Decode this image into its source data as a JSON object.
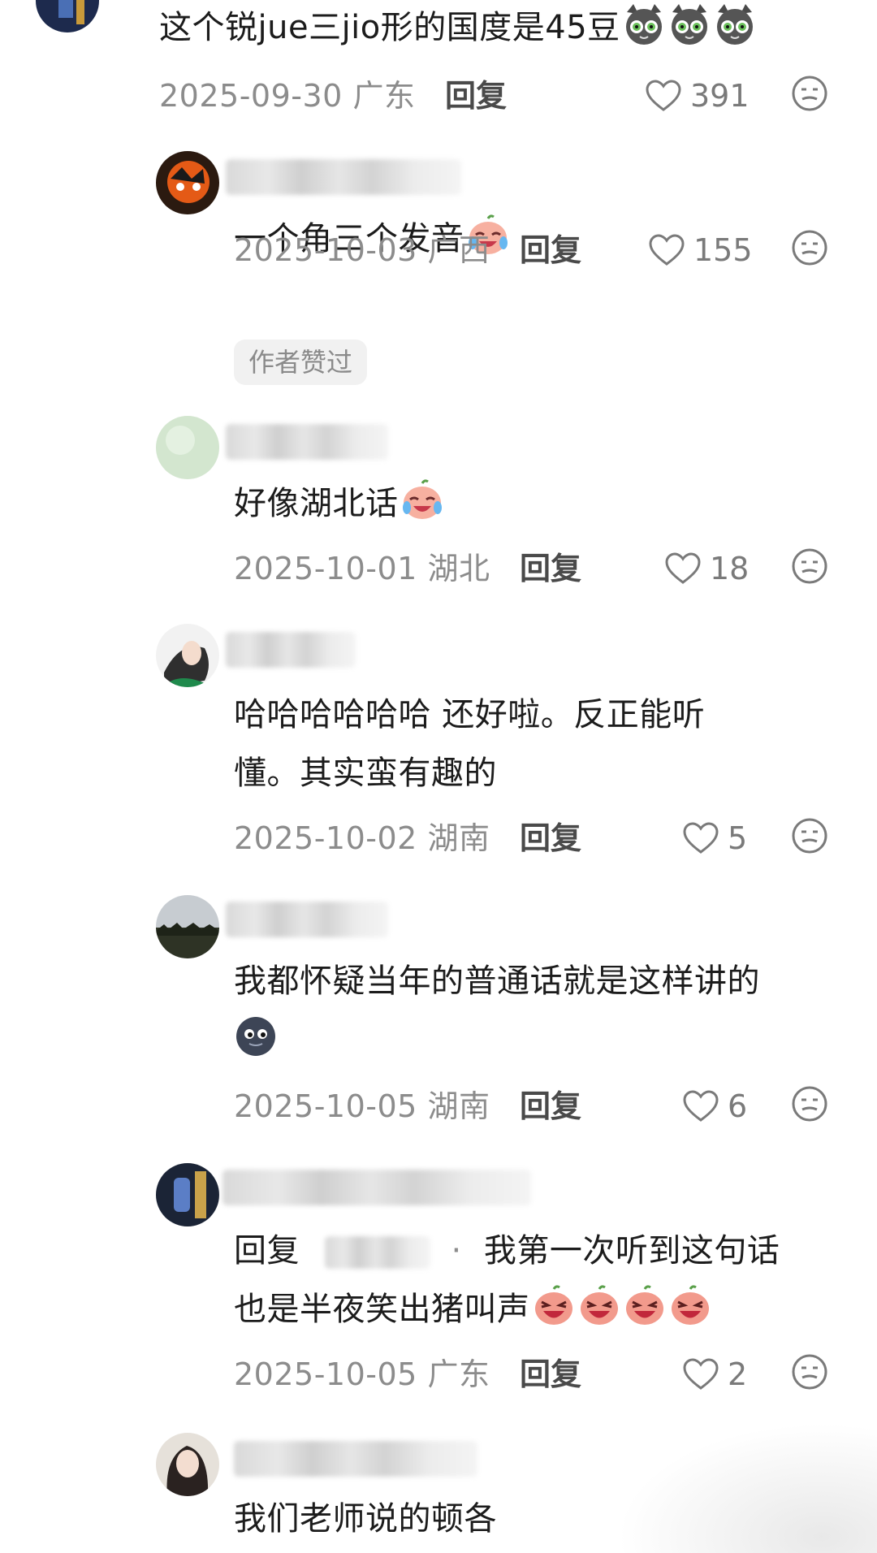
{
  "comments": [
    {
      "text": "这个锐jue三jio形的国度是45豆",
      "emojis": [
        "cat-emoji",
        "cat-emoji",
        "cat-emoji"
      ],
      "date": "2025-09-30",
      "location": "广东",
      "reply": "回复",
      "likes": "391"
    },
    {
      "username": "",
      "text": "一个角三个发音",
      "emojis": [
        "crying-laugh-emoji"
      ],
      "date": "2025-10-03",
      "location": "广西",
      "reply": "回复",
      "likes": "155",
      "badge": "作者赞过"
    },
    {
      "username": "",
      "text": "好像湖北话",
      "emojis": [
        "crying-laugh-emoji"
      ],
      "date": "2025-10-01",
      "location": "湖北",
      "reply": "回复",
      "likes": "18"
    },
    {
      "username": "",
      "text_line1": "哈哈哈哈哈哈 还好啦。反正能听",
      "text_line2": "懂。其实蛮有趣的",
      "date": "2025-10-02",
      "location": "湖南",
      "reply": "回复",
      "likes": "5"
    },
    {
      "username": "",
      "text": "我都怀疑当年的普通话就是这样讲的",
      "emojis": [
        "moon-face-emoji"
      ],
      "date": "2025-10-05",
      "location": "湖南",
      "reply": "回复",
      "likes": "6"
    },
    {
      "username": "",
      "reply_prefix": "回复",
      "reply_separator": "·",
      "text_line1": "我第一次听到这句话",
      "text_line2": "也是半夜笑出猪叫声",
      "emojis": [
        "laugh-emoji",
        "laugh-emoji",
        "laugh-emoji",
        "laugh-emoji"
      ],
      "date": "2025-10-05",
      "location": "广东",
      "reply": "回复",
      "likes": "2"
    },
    {
      "username": "",
      "text": "我们老师说的顿各"
    }
  ],
  "colors": {
    "meta_gray": "#8c8c8c",
    "text": "#1c1c1c",
    "badge_bg": "#f1f1f1"
  }
}
